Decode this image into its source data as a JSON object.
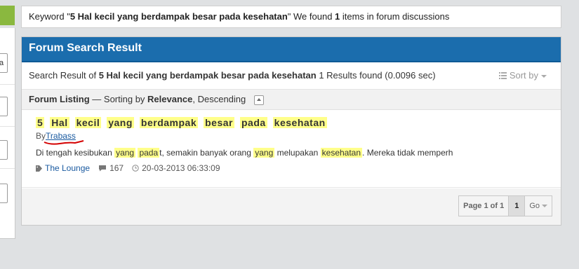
{
  "banner": {
    "prefix": "Keyword \"",
    "keyword": "5 Hal kecil yang berdampak besar pada kesehatan",
    "middle": "\" We found ",
    "count": "1",
    "suffix": " items in forum discussions"
  },
  "sidebar": {
    "field_text": "a"
  },
  "panel": {
    "title": "Forum Search Result",
    "summary_prefix": "Search Result of ",
    "summary_keyword": "5 Hal kecil yang berdampak besar pada kesehatan",
    "summary_suffix": " 1 Results found (0.0096 sec)",
    "sort_label": "Sort by"
  },
  "listing": {
    "label": "Forum Listing",
    "sorting_prefix": " — Sorting by ",
    "sort_field": "Relevance",
    "sort_order": ", Descending"
  },
  "result": {
    "title_words": [
      "5",
      "Hal",
      "kecil",
      "yang",
      "berdampak",
      "besar",
      "pada",
      "kesehatan"
    ],
    "by_label": "By",
    "author": "Trabass",
    "snippet": {
      "s1": "Di tengah kesibukan ",
      "h1": "yang",
      "s2": " ",
      "h2": "pada",
      "s3": "t, semakin banyak orang ",
      "h3": "yang",
      "s4": " melupakan ",
      "h4": "kesehatan",
      "s5": ". Mereka tidak memperh"
    },
    "forum": "The Lounge",
    "replies": "167",
    "date": "20-03-2013 06:33:09"
  },
  "pager": {
    "label": "Page 1 of 1",
    "current": "1",
    "go": "Go"
  },
  "colors": {
    "header_blue": "#1b6dad",
    "highlight": "#ffff8a",
    "link": "#1a5aa0",
    "accent_green": "#8ab83f",
    "annotation_red": "#d40000"
  }
}
